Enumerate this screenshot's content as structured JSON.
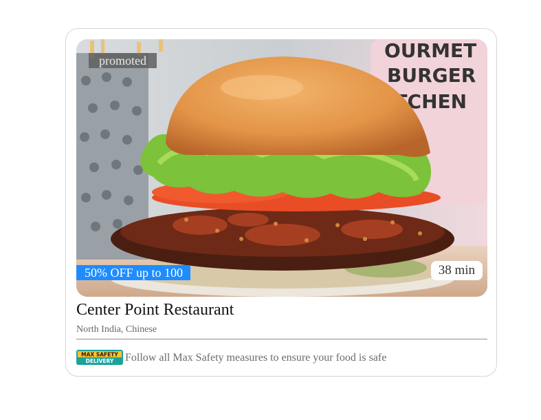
{
  "card": {
    "badge_promoted": "promoted",
    "offer_label": "50% OFF up to 100",
    "delivery_time": "38 min",
    "restaurant_name": "Center Point Restaurant",
    "cuisines": "North India, Chinese",
    "safety": {
      "logo_top": "MAX SAFETY",
      "logo_bottom": "DELIVERY",
      "message": "Follow all Max Safety measures to ensure your food is safe"
    },
    "photo_sign_lines": [
      "OURMET",
      "BURGER",
      "ITCHEN"
    ]
  },
  "colors": {
    "offer_blue": "#1e8cff",
    "promoted_gray": "#5f5f5f",
    "logo_teal": "#1aa39a"
  }
}
